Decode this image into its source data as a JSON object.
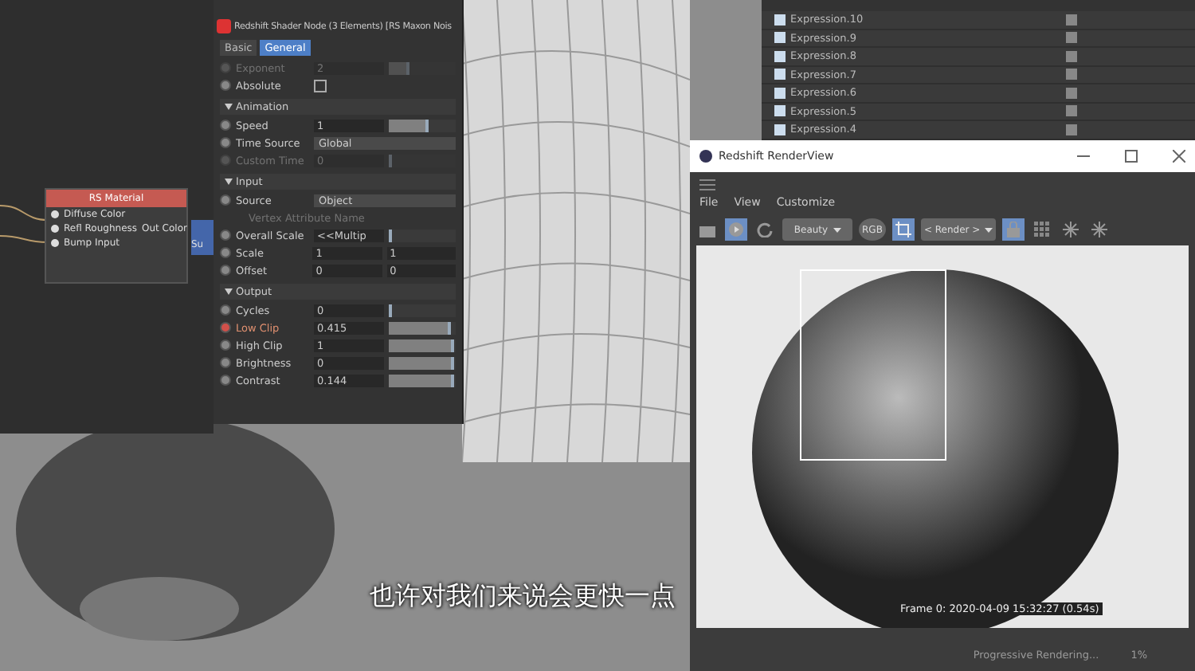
{
  "node_editor": {
    "node": {
      "title": "RS Material",
      "inputs": [
        "Diffuse Color",
        "Refl Roughness",
        "Bump Input"
      ],
      "output": "Out Color"
    },
    "side_node_label": "Su"
  },
  "attributes": {
    "title": "Redshift Shader Node (3 Elements) [RS Maxon Nois",
    "tabs": [
      {
        "label": "Basic",
        "selected": false
      },
      {
        "label": "General",
        "selected": true
      }
    ],
    "sections": [
      {
        "rows": [
          {
            "kind": "slider",
            "label": "Exponent",
            "value": "2",
            "disabled": true,
            "animated": false,
            "level": 0.3
          },
          {
            "kind": "checkbox",
            "label": "Absolute",
            "checked": false,
            "disabled": false,
            "animated": false
          }
        ]
      },
      {
        "title": "Animation",
        "rows": [
          {
            "kind": "slider",
            "label": "Speed",
            "value": "1",
            "disabled": false,
            "animated": false,
            "level": 0.6
          },
          {
            "kind": "dropdown",
            "label": "Time Source",
            "value": "Global",
            "disabled": false,
            "animated": false
          },
          {
            "kind": "slider",
            "label": "Custom Time",
            "value": "0",
            "disabled": true,
            "animated": false,
            "level": 0.02
          }
        ]
      },
      {
        "title": "Input",
        "rows": [
          {
            "kind": "dropdown",
            "label": "Source",
            "value": "Object",
            "disabled": false,
            "animated": false
          },
          {
            "kind": "caption",
            "label": "Vertex Attribute Name",
            "disabled": true
          },
          {
            "kind": "slider",
            "label": "Overall Scale",
            "value": "<<Multip",
            "disabled": false,
            "animated": false,
            "level": 0.05
          },
          {
            "kind": "pair",
            "label": "Scale",
            "value": "1",
            "value2": "1",
            "disabled": false,
            "animated": false
          },
          {
            "kind": "pair",
            "label": "Offset",
            "value": "0",
            "value2": "0",
            "disabled": false,
            "animated": false
          }
        ]
      },
      {
        "title": "Output",
        "rows": [
          {
            "kind": "slider",
            "label": "Cycles",
            "value": "0",
            "disabled": false,
            "animated": false,
            "level": 0.02
          },
          {
            "kind": "slider",
            "label": "Low Clip",
            "value": "0.415",
            "disabled": false,
            "animated": true,
            "level": 0.92
          },
          {
            "kind": "slider",
            "label": "High Clip",
            "value": "1",
            "disabled": false,
            "animated": false,
            "level": 0.97
          },
          {
            "kind": "slider",
            "label": "Brightness",
            "value": "0",
            "disabled": false,
            "animated": false,
            "level": 0.97
          },
          {
            "kind": "slider",
            "label": "Contrast",
            "value": "0.144",
            "disabled": false,
            "animated": false,
            "level": 0.97
          }
        ]
      }
    ]
  },
  "object_manager": {
    "items": [
      "Expression.10",
      "Expression.9",
      "Expression.8",
      "Expression.7",
      "Expression.6",
      "Expression.5",
      "Expression.4"
    ]
  },
  "render_view": {
    "title": "Redshift RenderView",
    "menu": [
      "File",
      "View",
      "Customize"
    ],
    "toolbar": [
      {
        "kind": "clapper",
        "selected": false
      },
      {
        "kind": "play",
        "selected": true
      },
      {
        "kind": "refresh",
        "selected": false
      },
      {
        "kind": "dropdown",
        "label": "Beauty",
        "selected": false
      },
      {
        "kind": "rgb",
        "label": "RGB",
        "selected": false
      },
      {
        "kind": "crop",
        "selected": true
      },
      {
        "kind": "dropdown",
        "label": "< Render >",
        "selected": false
      },
      {
        "kind": "lock",
        "selected": true
      },
      {
        "kind": "grid",
        "selected": false
      },
      {
        "kind": "snow",
        "selected": false
      },
      {
        "kind": "snow",
        "selected": false
      }
    ],
    "frame_info": "Frame 0: 2020-04-09 15:32:27 (0.54s)",
    "status": "Progressive Rendering...",
    "progress": "1%"
  },
  "subtitle": "也许对我们来说会更快一点"
}
